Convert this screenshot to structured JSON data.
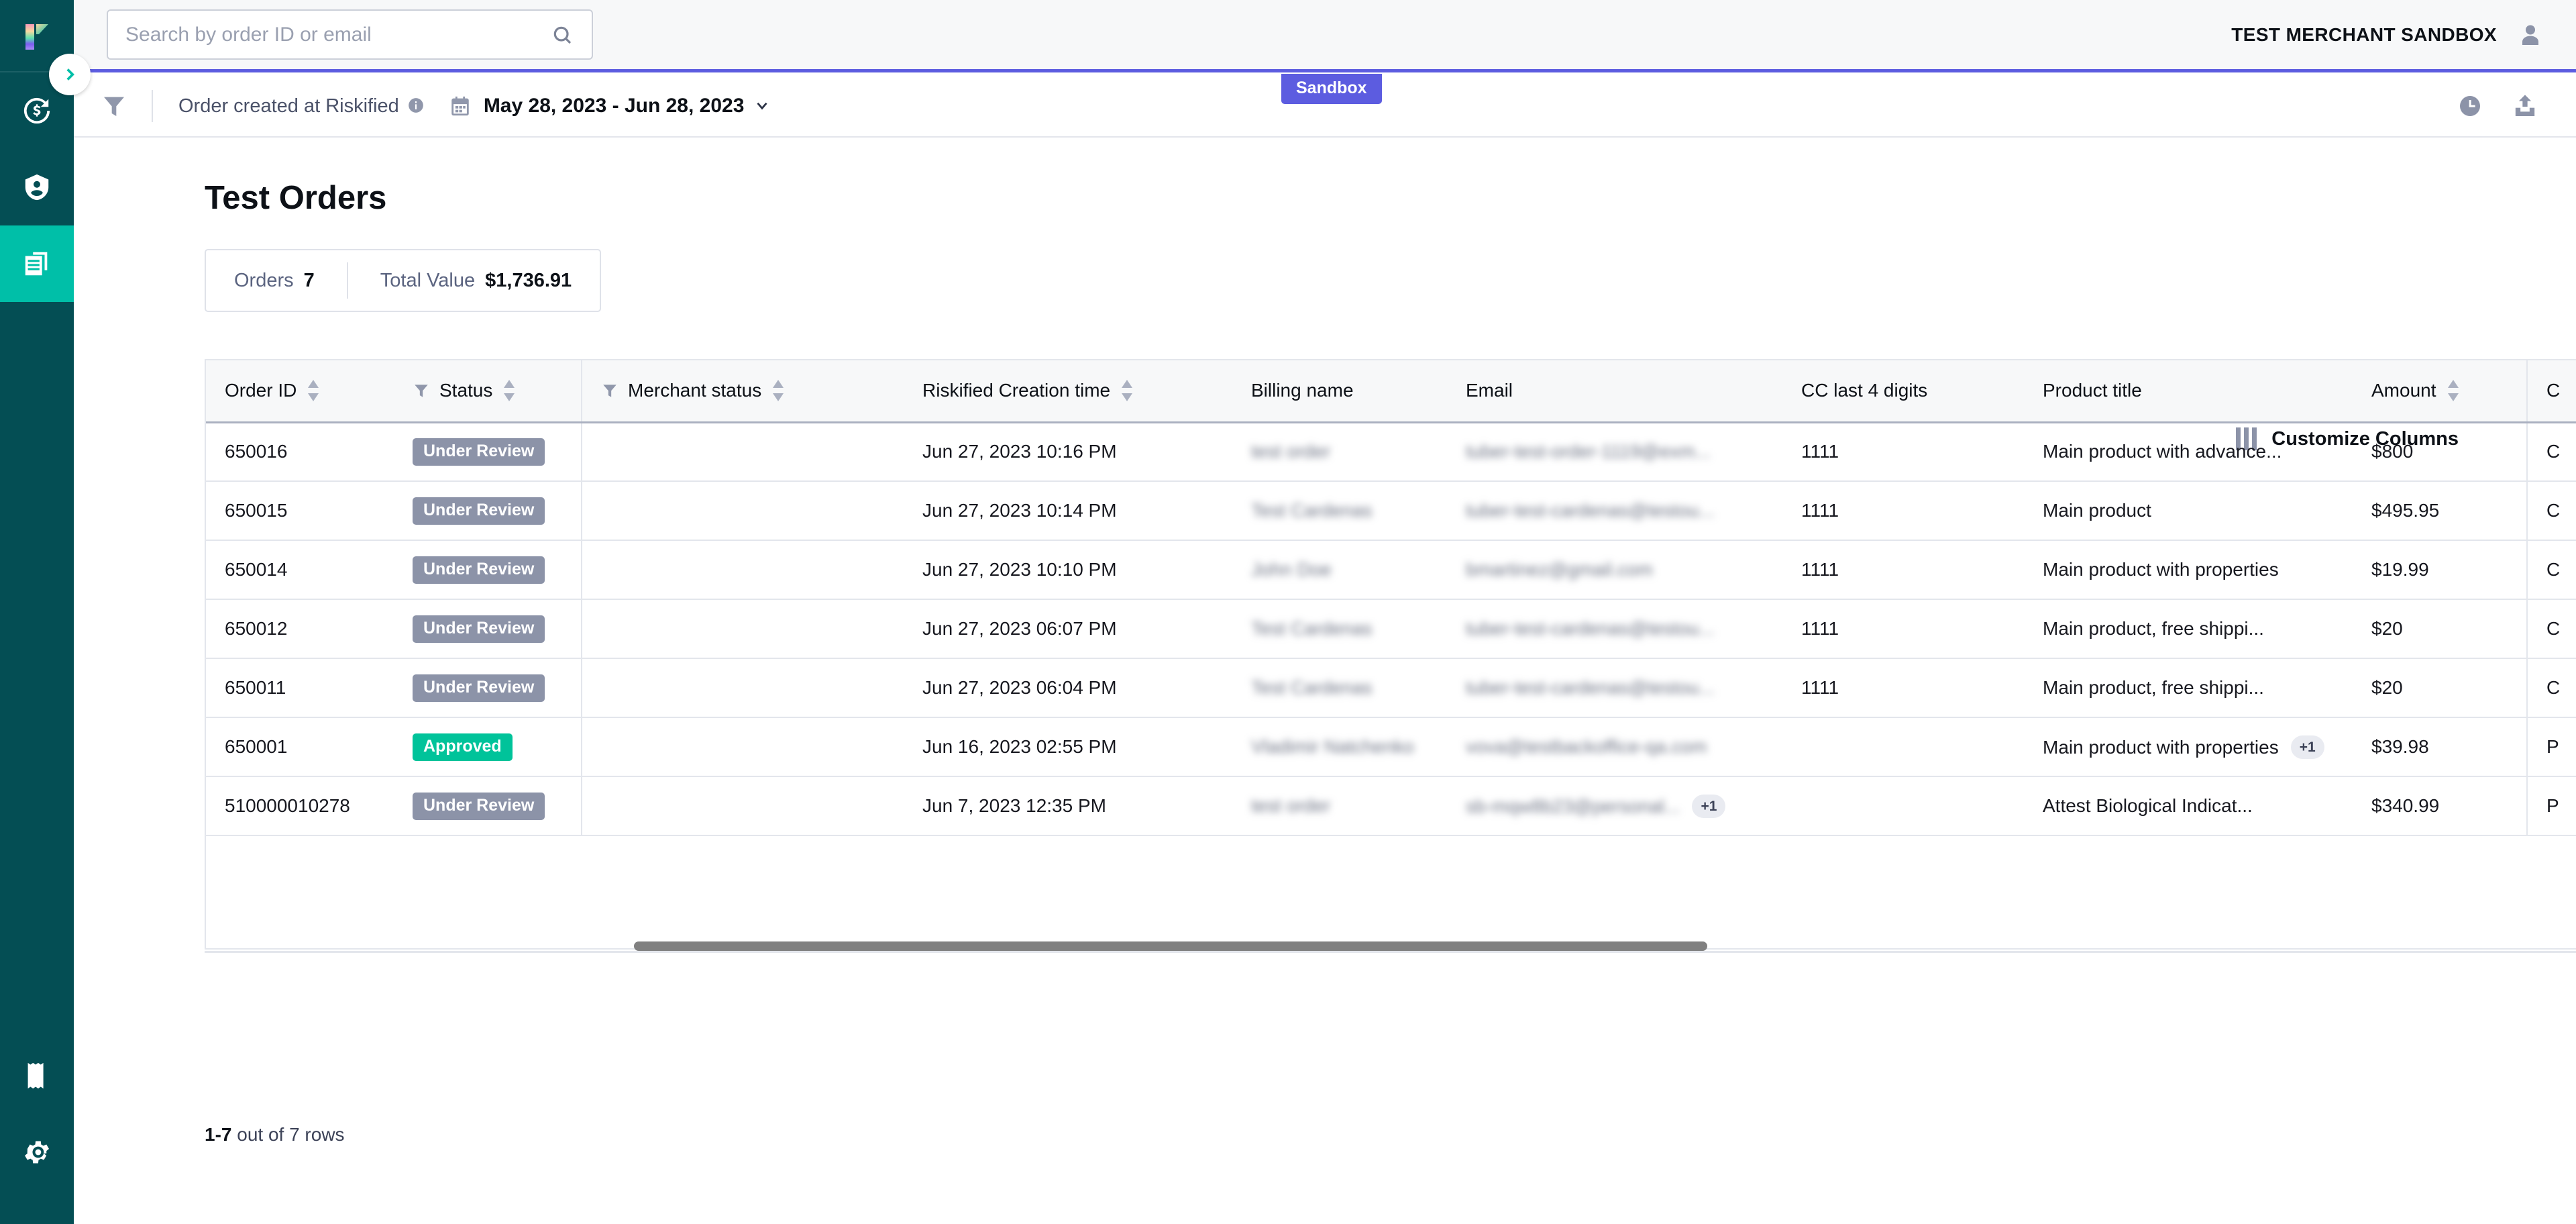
{
  "brand": {
    "logo_name": "riskified-logo",
    "accent_teal": "#00bfa8",
    "sidebar_bg": "#044e54",
    "sandbox_purple": "#5c5ce0"
  },
  "sidebar": {
    "collapse_toggle_icon": "chevron-right-icon",
    "items": [
      {
        "icon": "chargeback-dollar-icon",
        "label": "Chargebacks",
        "active": false
      },
      {
        "icon": "account-protection-shield-icon",
        "label": "Account Protection",
        "active": false
      },
      {
        "icon": "orders-documents-icon",
        "label": "Orders",
        "active": true
      }
    ],
    "bottom_items": [
      {
        "icon": "billing-receipt-icon",
        "label": "Billing"
      },
      {
        "icon": "settings-gear-icon",
        "label": "Settings"
      }
    ]
  },
  "topbar": {
    "search": {
      "placeholder": "Search by order ID or email",
      "value": "",
      "icon": "search-icon"
    },
    "merchant_name": "TEST MERCHANT SANDBOX",
    "avatar_icon": "avatar-icon"
  },
  "sandbox_badge": "Sandbox",
  "filterbar": {
    "funnel_icon": "funnel-filter-icon",
    "created_label": "Order created at Riskified",
    "info_icon": "info-icon",
    "calendar_icon": "calendar-icon",
    "date_range": "May 28, 2023 - Jun 28, 2023",
    "chevron_icon": "chevron-down-icon",
    "history_icon": "clock-history-icon",
    "export_icon": "export-upload-icon"
  },
  "main": {
    "page_title": "Test Orders",
    "summary": {
      "orders_label": "Orders",
      "orders_value": "7",
      "total_value_label": "Total Value",
      "total_value_value": "$1,736.91"
    },
    "customize_columns": {
      "label": "Customize Columns",
      "icon": "columns-icon"
    },
    "row_count_bold": "1-7",
    "row_count_rest": " out of 7 rows"
  },
  "table": {
    "columns": [
      {
        "key": "order_id",
        "label": "Order ID",
        "sortable": true,
        "filterable": false
      },
      {
        "key": "status",
        "label": "Status",
        "sortable": true,
        "filterable": true
      },
      {
        "key": "merchant_status",
        "label": "Merchant status",
        "sortable": true,
        "filterable": true
      },
      {
        "key": "created",
        "label": "Riskified Creation time",
        "sortable": true,
        "filterable": false
      },
      {
        "key": "billing",
        "label": "Billing name",
        "sortable": false,
        "filterable": false
      },
      {
        "key": "email",
        "label": "Email",
        "sortable": false,
        "filterable": false
      },
      {
        "key": "cc4",
        "label": "CC last 4 digits",
        "sortable": false,
        "filterable": false
      },
      {
        "key": "product",
        "label": "Product title",
        "sortable": false,
        "filterable": false
      },
      {
        "key": "amount",
        "label": "Amount",
        "sortable": true,
        "filterable": false
      },
      {
        "key": "currency",
        "label": "C",
        "sortable": false,
        "filterable": false
      }
    ],
    "rows": [
      {
        "order_id": "650016",
        "status": "Under Review",
        "status_type": "review",
        "merchant_status": "",
        "created": "Jun 27, 2023 10:16 PM",
        "billing": "test order",
        "email": "tuber-test-order-1119@exm...",
        "email_extra": "",
        "cc4": "1111",
        "cc4_extra": "",
        "product": "Main product with advance...",
        "product_extra": "",
        "amount": "$800",
        "currency": "C"
      },
      {
        "order_id": "650015",
        "status": "Under Review",
        "status_type": "review",
        "merchant_status": "",
        "created": "Jun 27, 2023 10:14 PM",
        "billing": "Test Cardenas",
        "email": "tuber-test-cardenas@testou...",
        "email_extra": "",
        "cc4": "1111",
        "cc4_extra": "",
        "product": "Main product",
        "product_extra": "",
        "amount": "$495.95",
        "currency": "C"
      },
      {
        "order_id": "650014",
        "status": "Under Review",
        "status_type": "review",
        "merchant_status": "",
        "created": "Jun 27, 2023 10:10 PM",
        "billing": "John Doe",
        "email": "bmartinez@gmail.com",
        "email_extra": "",
        "cc4": "1111",
        "cc4_extra": "",
        "product": "Main product with properties",
        "product_extra": "",
        "amount": "$19.99",
        "currency": "C"
      },
      {
        "order_id": "650012",
        "status": "Under Review",
        "status_type": "review",
        "merchant_status": "",
        "created": "Jun 27, 2023 06:07 PM",
        "billing": "Test Cardenas",
        "email": "tuber-test-cardenas@testou...",
        "email_extra": "",
        "cc4": "1111",
        "cc4_extra": "",
        "product": "Main product, free shippi...",
        "product_extra": "",
        "amount": "$20",
        "currency": "C"
      },
      {
        "order_id": "650011",
        "status": "Under Review",
        "status_type": "review",
        "merchant_status": "",
        "created": "Jun 27, 2023 06:04 PM",
        "billing": "Test Cardenas",
        "email": "tuber-test-cardenas@testou...",
        "email_extra": "",
        "cc4": "1111",
        "cc4_extra": "",
        "product": "Main product, free shippi...",
        "product_extra": "",
        "amount": "$20",
        "currency": "C"
      },
      {
        "order_id": "650001",
        "status": "Approved",
        "status_type": "approved",
        "merchant_status": "",
        "created": "Jun 16, 2023 02:55 PM",
        "billing": "Vladimir Natchenko",
        "email": "vova@testbackoffice-qa.com",
        "email_extra": "",
        "cc4": "",
        "cc4_extra": "",
        "product": "Main product with properties",
        "product_extra": "+1",
        "amount": "$39.98",
        "currency": "P"
      },
      {
        "order_id": "510000010278",
        "status": "Under Review",
        "status_type": "review",
        "merchant_status": "",
        "created": "Jun 7, 2023 12:35 PM",
        "billing": "test order",
        "email": "sb-mqw8b23@personal...",
        "email_extra": "+1",
        "cc4": "",
        "cc4_extra": "",
        "product": "Attest Biological Indicat...",
        "product_extra": "",
        "amount": "$340.99",
        "currency": "P"
      }
    ]
  }
}
